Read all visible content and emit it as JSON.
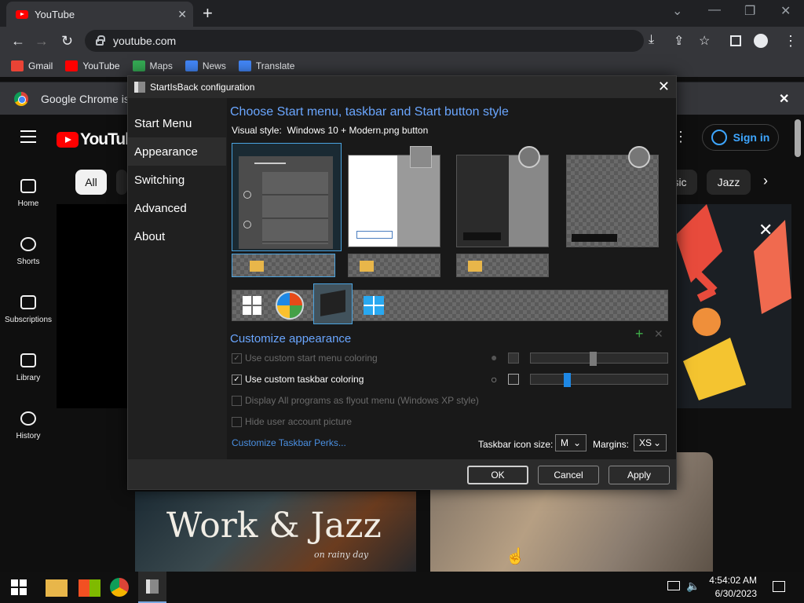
{
  "browser": {
    "tab_title": "YouTube",
    "tab_close": "✕",
    "new_tab": "+",
    "url": "youtube.com",
    "window_buttons": [
      "⌄",
      "—",
      "❐",
      "✕"
    ],
    "bookmarks": [
      {
        "label": "Gmail",
        "color": "#ea4335"
      },
      {
        "label": "YouTube",
        "color": "#ff0000"
      },
      {
        "label": "Maps",
        "color": "#34a853"
      },
      {
        "label": "News",
        "color": "#4285f4"
      },
      {
        "label": "Translate",
        "color": "#4285f4"
      }
    ],
    "infobar_text": "Google Chrome isn",
    "infobar_close": "✕"
  },
  "youtube": {
    "logo_text": "YouTube",
    "sign_in": "Sign in",
    "chips": [
      "All",
      "sic",
      "Jazz"
    ],
    "guide": [
      "Home",
      "Shorts",
      "Subscriptions",
      "Library",
      "History"
    ],
    "thumb1_text": "Work & Jazz",
    "thumb1_sub": "on rainy day"
  },
  "dialog": {
    "title": "StartIsBack configuration",
    "close": "✕",
    "nav": [
      "Start Menu",
      "Appearance",
      "Switching",
      "Advanced",
      "About"
    ],
    "selected_nav": "Appearance",
    "heading1": "Choose Start menu, taskbar and Start button style",
    "visual_style_label": "Visual style:",
    "visual_style_value": "Windows 10 + Modern.png button",
    "heading2": "Customize appearance",
    "options": [
      {
        "label": "Use custom start menu coloring",
        "checked": true,
        "enabled": false
      },
      {
        "label": "Use custom taskbar coloring",
        "checked": true,
        "enabled": true
      },
      {
        "label": "Display All programs as flyout menu (Windows XP style)",
        "checked": false,
        "enabled": false
      },
      {
        "label": "Hide user account picture",
        "checked": false,
        "enabled": false
      }
    ],
    "slider1_level": 0.45,
    "slider2_level": 0.25,
    "accent_color": "#1e88e5",
    "perks_link": "Customize Taskbar Perks...",
    "icon_size_label": "Taskbar icon size:",
    "icon_size_value": "M",
    "margins_label": "Margins:",
    "margins_value": "XS",
    "buttons": {
      "ok": "OK",
      "cancel": "Cancel",
      "apply": "Apply"
    },
    "add_icon": "+",
    "remove_icon": "✕"
  },
  "taskbar": {
    "time": "4:54:02 AM",
    "date": "6/30/2023"
  }
}
